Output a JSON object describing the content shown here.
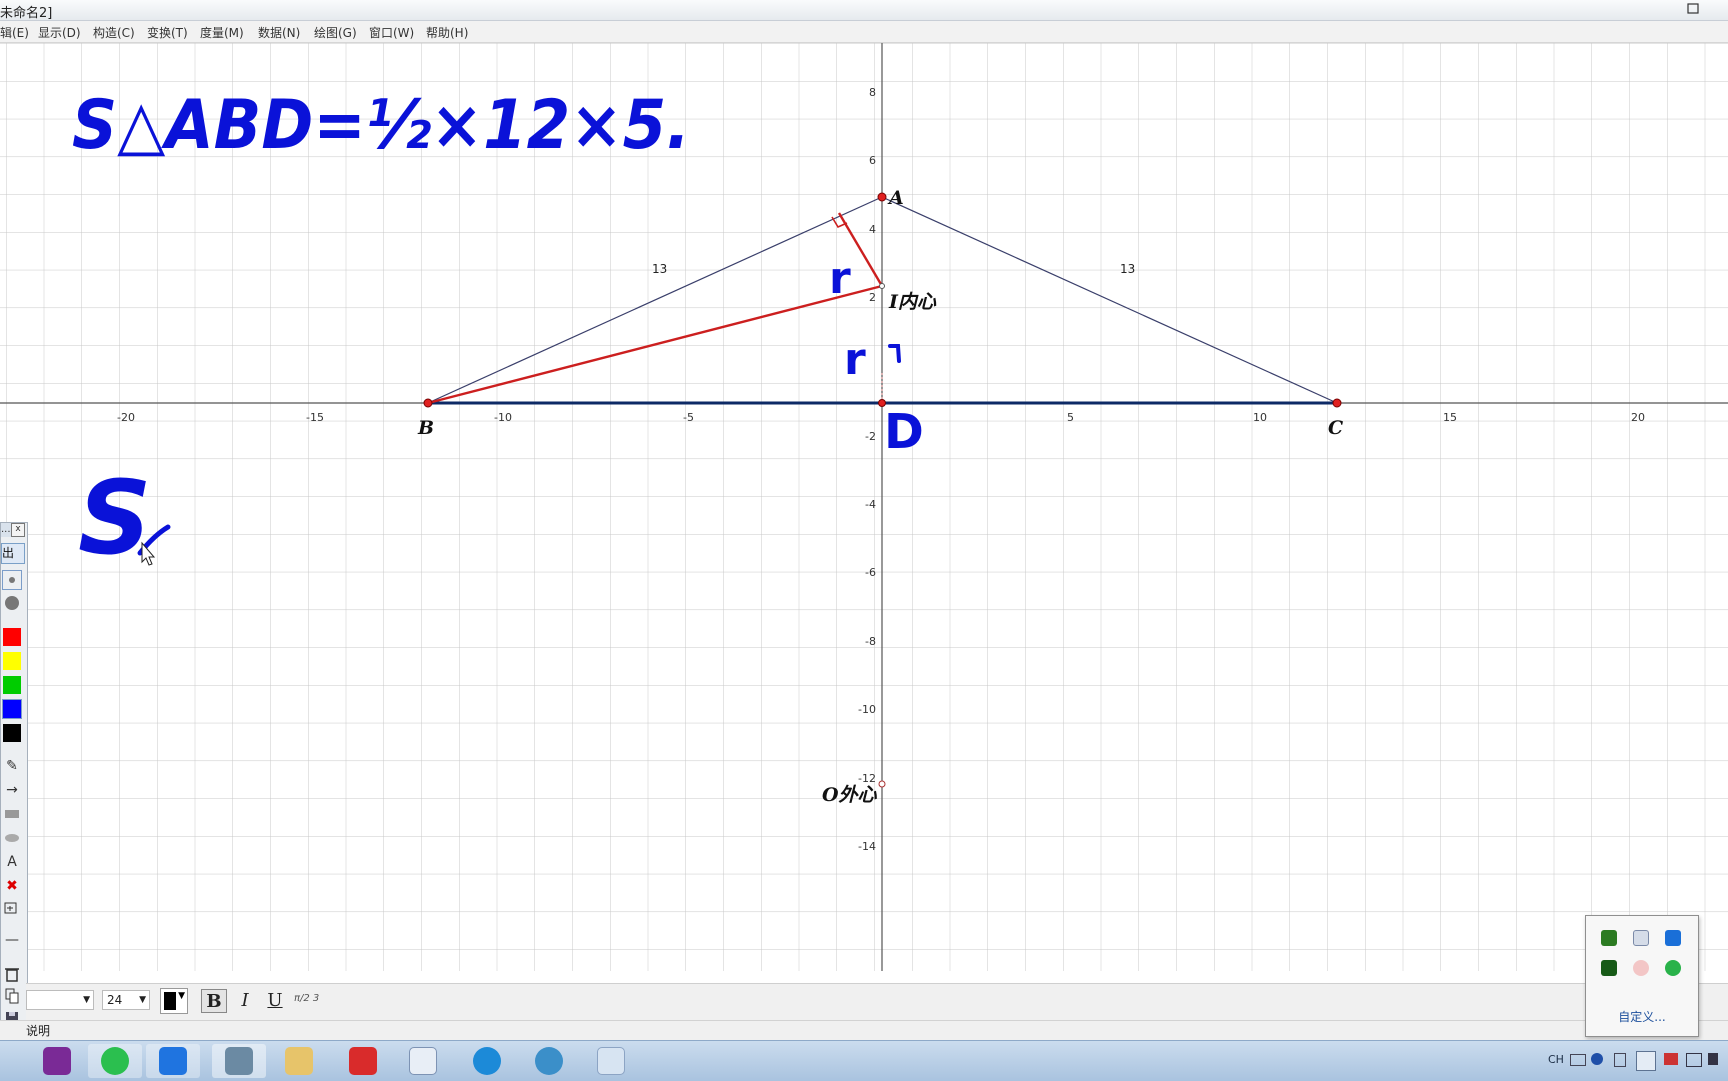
{
  "window": {
    "title": "未命名2]"
  },
  "menu": {
    "items": [
      "辑(E)",
      "显示(D)",
      "构造(C)",
      "变换(T)",
      "度量(M)",
      "数据(N)",
      "绘图(G)",
      "窗口(W)",
      "帮助(H)"
    ]
  },
  "graph": {
    "x_ticks": [
      "-20",
      "-15",
      "-10",
      "-5",
      "5",
      "10",
      "15",
      "20"
    ],
    "y_ticks": [
      "8",
      "6",
      "4",
      "2",
      "-2",
      "-4",
      "-6",
      "-8",
      "-10",
      "-12",
      "-14"
    ],
    "points": {
      "A": "A",
      "B": "B",
      "C": "C",
      "incenter": "I内心",
      "circumcenter": "O外心"
    },
    "side_labels": {
      "AB": "13",
      "AC": "13"
    },
    "colors": {
      "triangle": "#3a3f6b",
      "base": "#0d2a66",
      "incircle_radius": "#cc1f1f",
      "ink": "#0a12d8"
    }
  },
  "handwriting": {
    "formula": "S△ABD=½×12×5.",
    "radius_label_1": "r",
    "radius_label_2": "r",
    "foot_label": "D",
    "second_formula": "S"
  },
  "palette": {
    "top_label": "...",
    "exit_label": "出",
    "colors": [
      "#ff0000",
      "#ffff00",
      "#00cc00",
      "#0000ff",
      "#000000"
    ],
    "tools": [
      "pen-icon",
      "arrow-icon",
      "rectangle-icon",
      "ellipse-icon",
      "text-icon",
      "clear-icon",
      "zoom-icon",
      "line-icon",
      "trash-icon",
      "copy-icon",
      "save-icon",
      "info-icon"
    ]
  },
  "text_toolbar": {
    "font_size": "24",
    "bold": "B",
    "italic": "I",
    "underline": "U",
    "math": "π/2 3"
  },
  "statusbar": {
    "text": "说明"
  },
  "tray": {
    "customize": "自定义..."
  },
  "system": {
    "lang": "CH"
  }
}
